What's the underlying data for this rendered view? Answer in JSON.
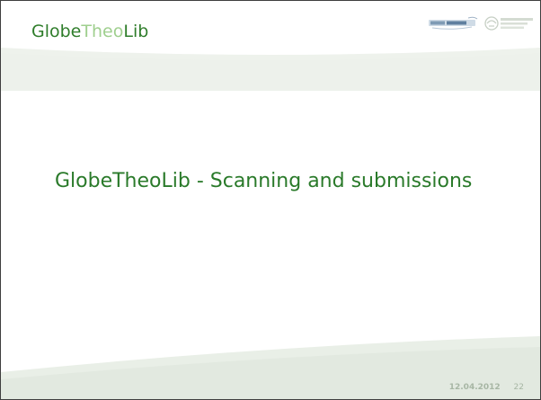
{
  "header": {
    "brand_part1": "Globe",
    "brand_part2": "Theo",
    "brand_part3": "Lib",
    "logo_globethics_text": "GlobeTheoLib",
    "logo_wcc_text": "World Council of Churches"
  },
  "main": {
    "heading": "GlobeTheoLib - Scanning and submissions"
  },
  "footer": {
    "date": "12.04.2012",
    "page_number": "22"
  },
  "colors": {
    "brand_dark": "#2f7d2b",
    "brand_light": "#9fcf8e",
    "heading": "#2a7a2a",
    "band": "#eef2ec",
    "footer_band": "#e4ebe2",
    "footer_text": "#a7b6a4"
  },
  "icons": [
    "globethics-logo-icon",
    "wcc-logo-icon"
  ]
}
